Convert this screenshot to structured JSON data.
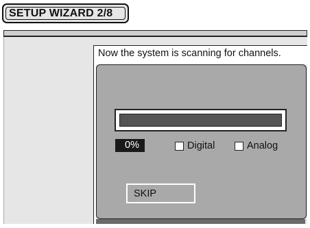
{
  "wizard": {
    "title": "SETUP WIZARD 2/8"
  },
  "scan": {
    "message": "Now the system is scanning for channels.",
    "progress_percent": 0,
    "progress_label": "0%",
    "options": [
      {
        "label": "Digital",
        "checked": false
      },
      {
        "label": "Analog",
        "checked": false
      }
    ]
  },
  "actions": {
    "skip_label": "SKIP"
  },
  "colors": {
    "panel_bg": "#e6e6e6",
    "dialog_bg": "#a9a9a9",
    "progress_track": "#555555",
    "badge_bg": "#1a1a1a"
  }
}
